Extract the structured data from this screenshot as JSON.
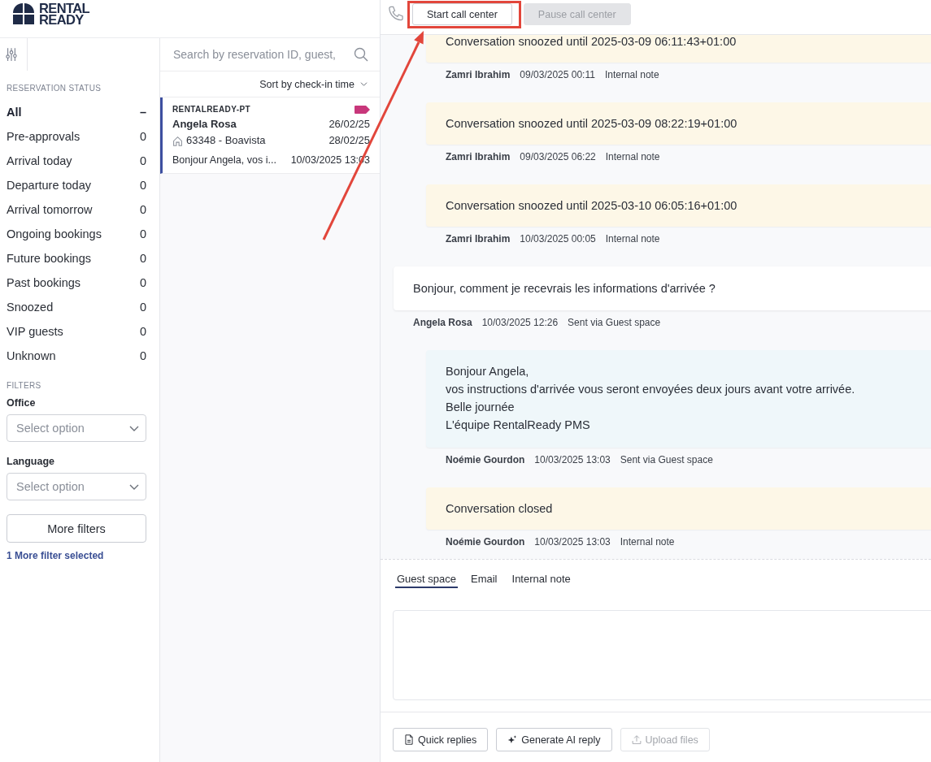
{
  "logo": {
    "lines": [
      "RENTAL",
      "READY"
    ]
  },
  "sidebar": {
    "section_title": "RESERVATION STATUS",
    "statuses": [
      {
        "label": "All",
        "count": "–",
        "selected": true
      },
      {
        "label": "Pre-approvals",
        "count": "0",
        "selected": false
      },
      {
        "label": "Arrival today",
        "count": "0",
        "selected": false
      },
      {
        "label": "Departure today",
        "count": "0",
        "selected": false
      },
      {
        "label": "Arrival tomorrow",
        "count": "0",
        "selected": false
      },
      {
        "label": "Ongoing bookings",
        "count": "0",
        "selected": false
      },
      {
        "label": "Future bookings",
        "count": "0",
        "selected": false
      },
      {
        "label": "Past bookings",
        "count": "0",
        "selected": false
      },
      {
        "label": "Snoozed",
        "count": "0",
        "selected": false
      },
      {
        "label": "VIP guests",
        "count": "0",
        "selected": false
      },
      {
        "label": "Unknown",
        "count": "0",
        "selected": false
      }
    ],
    "filters": {
      "title": "FILTERS",
      "fields": [
        {
          "label": "Office",
          "placeholder": "Select option"
        },
        {
          "label": "Language",
          "placeholder": "Select option"
        }
      ],
      "more_button": "More filters",
      "more_link": "1 More filter selected"
    }
  },
  "conversation_list": {
    "search": {
      "placeholder": "Search by reservation ID, guest,"
    },
    "sort": "Sort by check-in time",
    "items": [
      {
        "account": "RENTALREADY-PT",
        "guest": "Angela Rosa",
        "check_in": "26/02/25",
        "property": "63348 - Boavista",
        "check_out": "28/02/25",
        "preview": "Bonjour Angela, vos i...",
        "time": "10/03/2025 13:03",
        "selected": true
      }
    ]
  },
  "call_center": {
    "buttons": [
      {
        "label": "Start call center",
        "disabled": false
      },
      {
        "label": "Pause call center",
        "disabled": true
      }
    ]
  },
  "messages": [
    {
      "kind": "note",
      "text": "Conversation snoozed until 2025-03-09 06:11:43+01:00",
      "author": "Zamri Ibrahim",
      "time": "09/03/2025 00:11",
      "channel": "Internal note"
    },
    {
      "kind": "note",
      "text": "Conversation snoozed until 2025-03-09 08:22:19+01:00",
      "author": "Zamri Ibrahim",
      "time": "09/03/2025 06:22",
      "channel": "Internal note"
    },
    {
      "kind": "note",
      "text": "Conversation snoozed until 2025-03-10 06:05:16+01:00",
      "author": "Zamri Ibrahim",
      "time": "10/03/2025 00:05",
      "channel": "Internal note"
    },
    {
      "kind": "guest",
      "text": "Bonjour, comment je recevrais les informations d'arrivée ?",
      "author": "Angela Rosa",
      "time": "10/03/2025 12:26",
      "channel": "Sent via Guest space"
    },
    {
      "kind": "reply",
      "text": "Bonjour Angela,\nvos instructions d'arrivée vous seront envoyées deux jours avant votre arrivée.\nBelle journée\nL'équipe RentalReady PMS",
      "author": "Noémie Gourdon",
      "time": "10/03/2025 13:03",
      "channel": "Sent via Guest space"
    },
    {
      "kind": "note",
      "text": "Conversation closed",
      "author": "Noémie Gourdon",
      "time": "10/03/2025 13:03",
      "channel": "Internal note"
    }
  ],
  "composer": {
    "tabs": [
      {
        "label": "Guest space",
        "selected": true
      },
      {
        "label": "Email",
        "selected": false
      },
      {
        "label": "Internal note",
        "selected": false
      }
    ],
    "buttons": [
      {
        "kind": "quick",
        "label": "Quick replies",
        "disabled": false
      },
      {
        "kind": "ai",
        "label": "Generate AI reply",
        "disabled": false
      },
      {
        "kind": "upload",
        "label": "Upload files",
        "disabled": true
      }
    ]
  }
}
